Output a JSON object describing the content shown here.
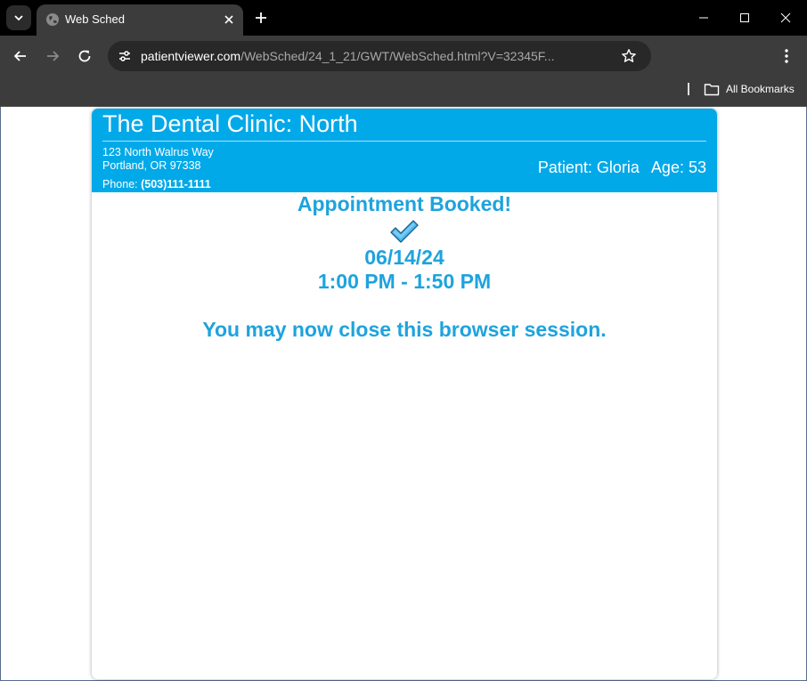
{
  "browser": {
    "tab": {
      "title": "Web Sched",
      "favicon": "globe-icon"
    },
    "address_bar": {
      "host": "patientviewer.com",
      "path": "/WebSched/24_1_21/GWT/WebSched.html?V=32345F..."
    },
    "bookmarks": {
      "label": "All Bookmarks"
    }
  },
  "clinic": {
    "name": "The Dental Clinic: North",
    "address_line1": "123 North Walrus Way",
    "address_line2": "Portland, OR 97338",
    "phone_label": "Phone:",
    "phone": "(503)111-1111"
  },
  "patient": {
    "name_label": "Patient:",
    "name": "Gloria",
    "age_label": "Age:",
    "age": "53"
  },
  "confirmation": {
    "title": "Appointment Booked!",
    "icon": "checkmark-icon",
    "date": "06/14/24",
    "time": "1:00 PM - 1:50 PM",
    "message": "You may now close this browser session."
  },
  "colors": {
    "header": "#02a9e9",
    "accent_text": "#1ea3dd",
    "chrome_dark": "#3c3c3c",
    "titlebar": "#000000"
  }
}
